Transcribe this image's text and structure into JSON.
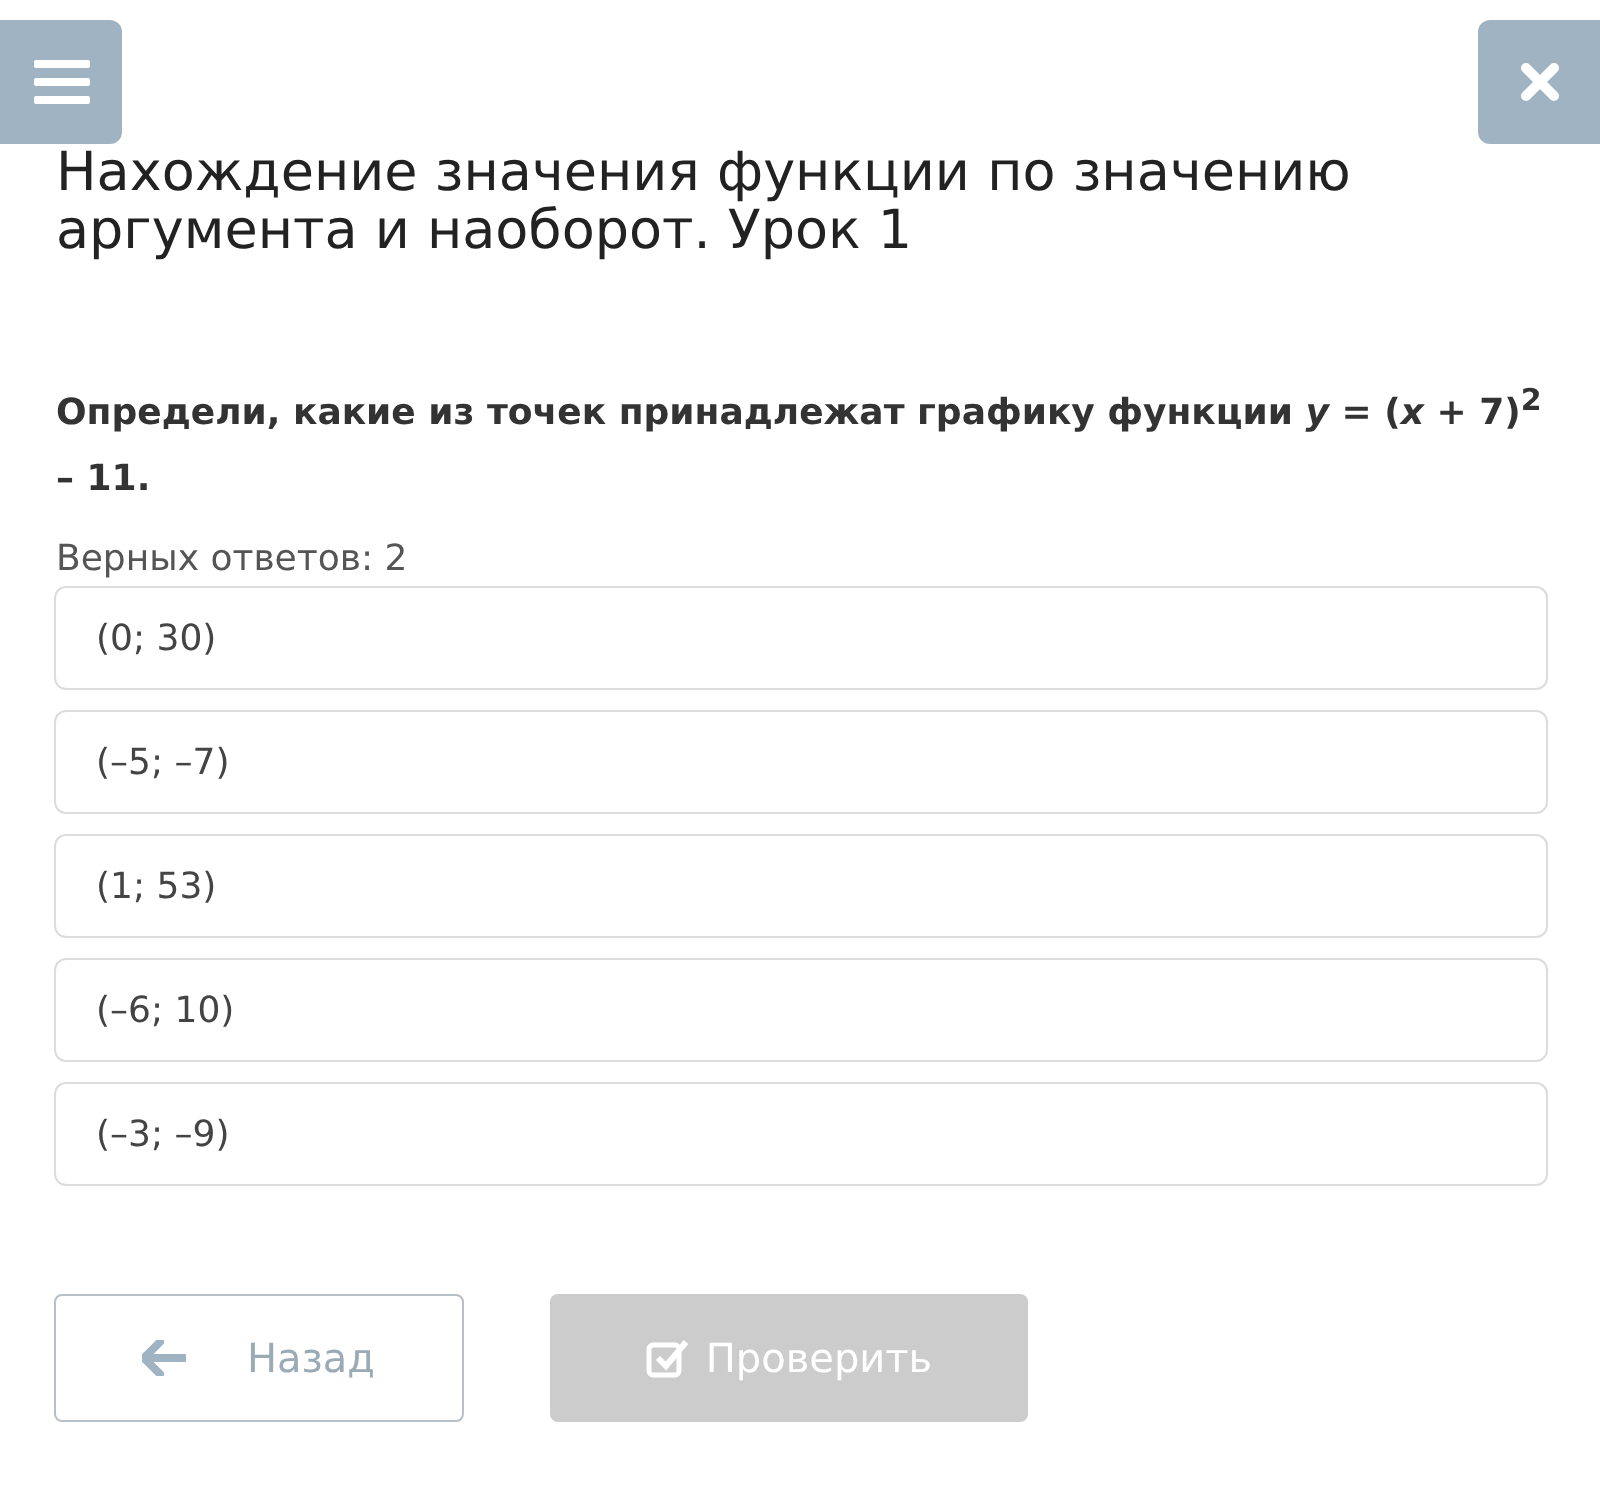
{
  "title": "Нахождение значения функции по значению аргумента и наоборот. Урок 1",
  "question": "Определи, какие из точек принадлежат графику функции *y* = (*x* + 7)$^{2}$ – 11.",
  "answers_count": "Верных ответов: 2",
  "options": [
    {
      "label": "(0; 30)",
      "selected": false
    },
    {
      "label": "(–5; –7)",
      "selected": false
    },
    {
      "label": "(1; 53)",
      "selected": false
    },
    {
      "label": "(–6; 10)",
      "selected": false
    },
    {
      "label": "(–3; –9)",
      "selected": false
    }
  ],
  "back_button": {
    "label": "Назад"
  },
  "check_button": {
    "label": "Проверить",
    "disabled": true
  }
}
